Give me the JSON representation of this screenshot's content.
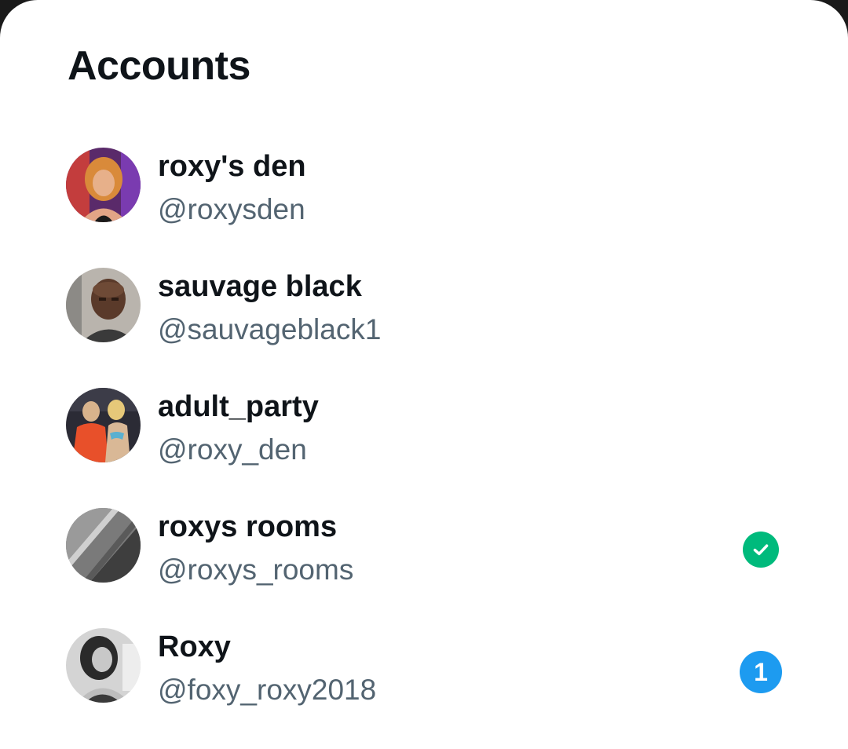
{
  "header": {
    "title": "Accounts"
  },
  "accounts": [
    {
      "name": "roxy's den",
      "handle": "@roxysden",
      "status": null
    },
    {
      "name": "sauvage black",
      "handle": "@sauvageblack1",
      "status": null
    },
    {
      "name": "adult_party",
      "handle": "@roxy_den",
      "status": null
    },
    {
      "name": "roxys rooms",
      "handle": "@roxys_rooms",
      "status": "current",
      "status_icon": "check-circle-icon"
    },
    {
      "name": "Roxy",
      "handle": "@foxy_roxy2018",
      "status": "notifications",
      "badge_count": "1"
    }
  ],
  "colors": {
    "accent_blue": "#1d9bf0",
    "success_green": "#00ba7c",
    "text_primary": "#0f1419",
    "text_secondary": "#536471"
  }
}
